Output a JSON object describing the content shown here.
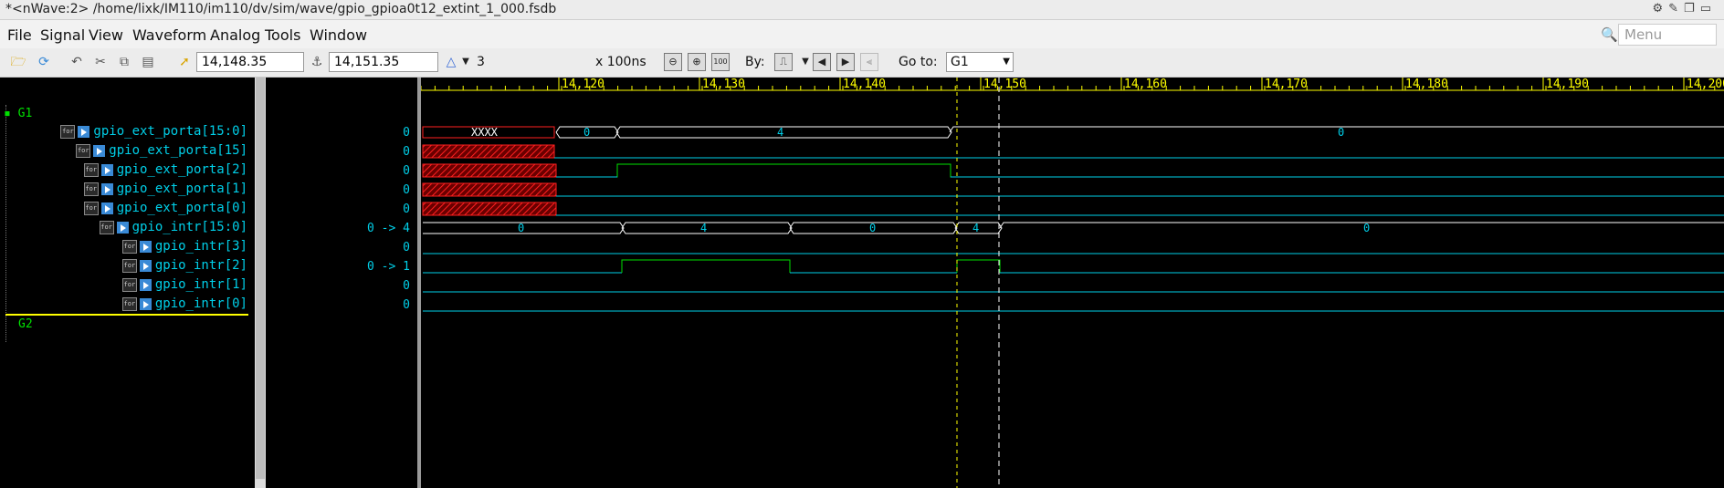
{
  "window": {
    "title": "*<nWave:2> /home/lixk/IM110/im110/dv/sim/wave/gpio_gpioa0t12_extint_1_000.fsdb"
  },
  "menu": {
    "items": [
      "File",
      "Signal",
      "View",
      "Waveform",
      "Analog",
      "Tools",
      "Window"
    ],
    "search_placeholder": "Menu"
  },
  "toolbar": {
    "cursor_time": "14,148.35",
    "marker_time": "14,151.35",
    "delta": "3",
    "time_unit": "x 100ns",
    "by_label": "By:",
    "goto_label": "Go to:",
    "goto_value": "G1",
    "icons": [
      "open-folder-icon",
      "reload-icon",
      "undo-icon",
      "cut-icon",
      "copy-icon",
      "paste-icon",
      "pointer-icon",
      "marker-icon",
      "delta-up-icon",
      "zoom-out-icon",
      "zoom-in-icon",
      "zoom-fit-icon",
      "edge-icon",
      "prev-icon",
      "next-icon"
    ]
  },
  "groups": [
    {
      "name": "G1"
    },
    {
      "name": "G2"
    }
  ],
  "signals": [
    {
      "name": "gpio_ext_porta[15:0]",
      "value": "0"
    },
    {
      "name": "gpio_ext_porta[15]",
      "value": "0"
    },
    {
      "name": "gpio_ext_porta[2]",
      "value": "0"
    },
    {
      "name": "gpio_ext_porta[1]",
      "value": "0"
    },
    {
      "name": "gpio_ext_porta[0]",
      "value": "0"
    },
    {
      "name": "gpio_intr[15:0]",
      "value": "0 -> 4"
    },
    {
      "name": "gpio_intr[3]",
      "value": "0"
    },
    {
      "name": "gpio_intr[2]",
      "value": "0 -> 1"
    },
    {
      "name": "gpio_intr[1]",
      "value": "0"
    },
    {
      "name": "gpio_intr[0]",
      "value": "0"
    }
  ],
  "ruler": {
    "ticks": [
      "14,120",
      "14,130",
      "14,140",
      "14,150",
      "14,160",
      "14,170",
      "14,180",
      "14,190",
      "14,200"
    ]
  },
  "waveform": {
    "porta_bus_labels": [
      "XXXX",
      "0",
      "4",
      "0"
    ],
    "intr_bus_labels": [
      "0",
      "4",
      "0",
      "4",
      "0"
    ],
    "colors": {
      "background": "#000000",
      "signal": "#00cfe8",
      "high": "#00e000",
      "unknown": "#ff2020",
      "cursor": "#ffff00",
      "marker": "#ffffff",
      "ruler": "#ffff00"
    }
  }
}
